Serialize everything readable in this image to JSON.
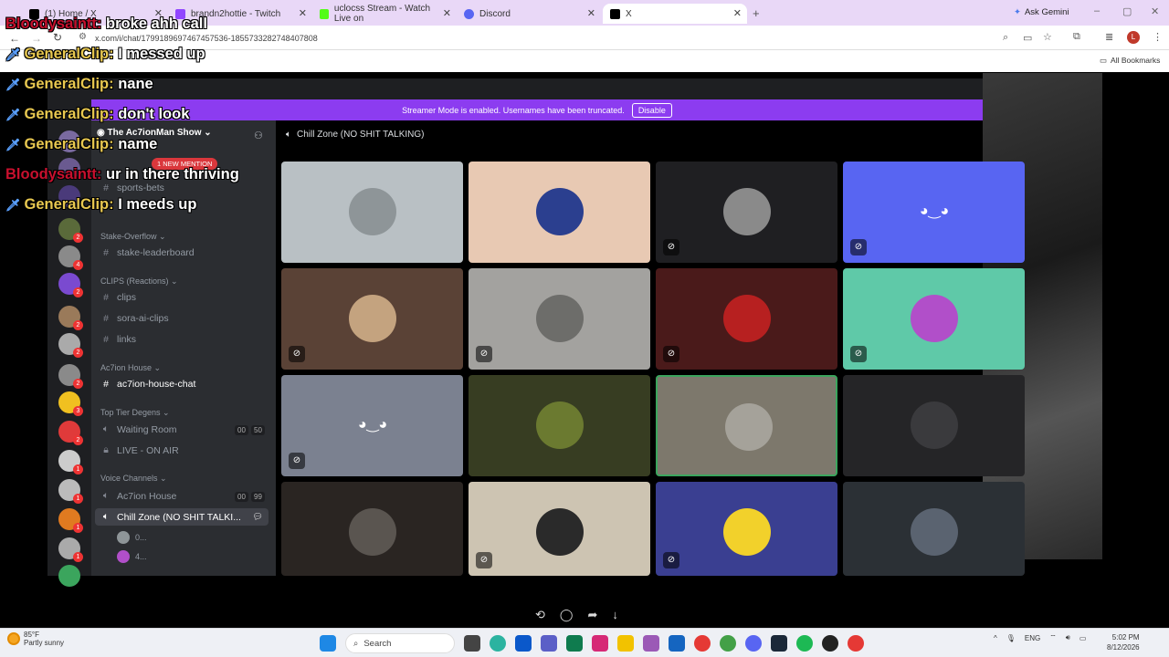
{
  "browser": {
    "tabs": [
      {
        "label": "(1) Home / X",
        "icon": "x-logo-icon",
        "color": "#000000"
      },
      {
        "label": "brandn2hottie - Twitch",
        "icon": "twitch-icon",
        "color": "#9146ff"
      },
      {
        "label": "uclocss Stream - Watch Live on",
        "icon": "kick-icon",
        "color": "#53fc18"
      },
      {
        "label": "Discord",
        "icon": "discord-icon",
        "color": "#5865f2"
      },
      {
        "label": "X",
        "icon": "x-logo-icon",
        "color": "#000000"
      }
    ],
    "new_tab": "+",
    "gemini": "Ask Gemini",
    "url": "x.com/i/chat/1799189697467457536-1855733282748407808",
    "all_bookmarks": "All Bookmarks",
    "profile_initial": "L"
  },
  "chat": [
    {
      "name": "Bloodysaintt:",
      "msg": "broke ahh call",
      "red": true,
      "badge": false
    },
    {
      "name": "GeneralClip:",
      "msg": "I messed up",
      "red": false,
      "badge": true
    },
    {
      "name": "GeneralClip:",
      "msg": "nane",
      "red": false,
      "badge": true
    },
    {
      "name": "GeneralClip:",
      "msg": "don't look",
      "red": false,
      "badge": true
    },
    {
      "name": "GeneralClip:",
      "msg": "name",
      "red": false,
      "badge": true
    },
    {
      "name": "Bloodysaintt:",
      "msg": "ur in there thriving",
      "red": true,
      "badge": false
    },
    {
      "name": "GeneralClip:",
      "msg": "I meeds up",
      "red": false,
      "badge": true
    }
  ],
  "discord": {
    "banner_text": "Streamer Mode is enabled. Usernames have been truncated.",
    "banner_button": "Disable",
    "server_name": "The Ac7ionMan Show",
    "new_mention": "1 NEW MENTION",
    "channels": {
      "sports_bets": "sports-bets",
      "cat_stake": "Stake-Overflow",
      "stake_leaderboard": "stake-leaderboard",
      "cat_clips": "CLIPS (Reactions)",
      "clips": "clips",
      "sora": "sora-ai-clips",
      "links": "links",
      "cat_house": "Ac7ion House",
      "house_chat": "ac7ion-house-chat",
      "cat_degens": "Top Tier Degens",
      "waiting": "Waiting Room",
      "waiting_a": "00",
      "waiting_b": "50",
      "live": "LIVE - ON AIR",
      "cat_voice": "Voice Channels",
      "ac7ion_house": "Ac7ion House",
      "ac7ion_a": "00",
      "ac7ion_b": "99",
      "chill": "Chill Zone (NO SHIT TALKI...",
      "user1": "0...",
      "user2": "4..."
    },
    "voice_channel_title": "Chill Zone (NO SHIT TALKING)",
    "tiles": [
      {
        "bg": "#b9c0c4",
        "av": "#8e9598",
        "mute": false
      },
      {
        "bg": "#e8c9b3",
        "av": "#2b3f8f",
        "mute": false
      },
      {
        "bg": "#1f1f22",
        "av": "#8a8a8a",
        "mute": true
      },
      {
        "bg": "#5865f2",
        "av": "discord",
        "mute": true
      },
      {
        "bg": "#5a4236",
        "av": "#c4a37f",
        "mute": true
      },
      {
        "bg": "#a3a29f",
        "av": "#6d6d6a",
        "mute": true
      },
      {
        "bg": "#4a1a1a",
        "av": "#b72020",
        "mute": true
      },
      {
        "bg": "#5fc9a8",
        "av": "#b14fc9",
        "mute": true
      },
      {
        "bg": "#7b8190",
        "av": "discord",
        "mute": true
      },
      {
        "bg": "#373d22",
        "av": "#6b7a30",
        "mute": false
      },
      {
        "bg": "#7d786c",
        "av": "#a5a29a",
        "mute": false
      },
      {
        "bg": "#252527",
        "av": "#3a3a3d",
        "mute": false
      },
      {
        "bg": "#2a2522",
        "av": "#5a5550",
        "mute": false
      },
      {
        "bg": "#cdc4b2",
        "av": "#2a2a2a",
        "mute": true
      },
      {
        "bg": "#3a3f91",
        "av": "#f2d12b",
        "mute": true
      },
      {
        "bg": "#2b3035",
        "av": "#5a6370",
        "mute": false
      }
    ]
  },
  "taskbar": {
    "temp": "85°F",
    "weather": "Partly sunny",
    "search": "Search",
    "lang": "ENG",
    "time": "5:02 PM",
    "date": "8/12/2026"
  }
}
